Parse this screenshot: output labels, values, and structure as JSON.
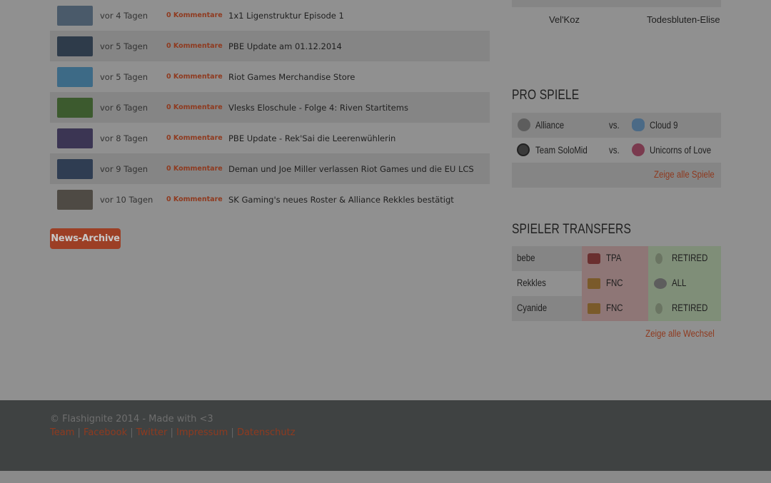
{
  "news": [
    {
      "ago": "vor 4 Tagen",
      "comments": "0 Kommentare",
      "title": "1x1 Ligenstruktur Episode 1",
      "thumb_color": "#4a5a6a",
      "alt": false
    },
    {
      "ago": "vor 5 Tagen",
      "comments": "0 Kommentare",
      "title": "PBE Update am 01.12.2014",
      "thumb_color": "#2e3b4a",
      "alt": true
    },
    {
      "ago": "vor 5 Tagen",
      "comments": "0 Kommentare",
      "title": "Riot Games Merchandise Store",
      "thumb_color": "#3d6a86",
      "alt": false
    },
    {
      "ago": "vor 6 Tagen",
      "comments": "0 Kommentare",
      "title": "Vlesks Eloschule - Folge 4: Riven Startitems",
      "thumb_color": "#3c5a2e",
      "alt": true
    },
    {
      "ago": "vor 8 Tagen",
      "comments": "0 Kommentare",
      "title": "PBE Update - Rek'Sai die Leerenwühlerin",
      "thumb_color": "#3b3553",
      "alt": false
    },
    {
      "ago": "vor 9 Tagen",
      "comments": "0 Kommentare",
      "title": "Deman und Joe Miller verlassen Riot Games und die EU LCS",
      "thumb_color": "#2f3d52",
      "alt": true
    },
    {
      "ago": "vor 10 Tagen",
      "comments": "0 Kommentare",
      "title": "SK Gaming's neues Roster & Alliance Rekkles bestätigt",
      "thumb_color": "#4e4a44",
      "alt": false
    }
  ],
  "archive_button": "News-Archive",
  "champions": {
    "left": "Vel'Koz",
    "right": "Todesbluten-Elise"
  },
  "pro_games": {
    "title": "PRO SPIELE",
    "matches": [
      {
        "team1": "Alliance",
        "vs": "vs.",
        "team2": "Cloud 9",
        "icon1": "alliance-logo-icon",
        "icon2": "cloud9-logo-icon"
      },
      {
        "team1": "Team SoloMid",
        "vs": "vs.",
        "team2": "Unicorns of Love",
        "icon1": "tsm-logo-icon",
        "icon2": "unicorns-of-love-logo-icon"
      }
    ],
    "show_all": "Zeige alle Spiele"
  },
  "transfers": {
    "title": "SPIELER TRANSFERS",
    "rows": [
      {
        "player": "bebe",
        "from": "TPA",
        "to": "RETIRED"
      },
      {
        "player": "Rekkles",
        "from": "FNC",
        "to": "ALL"
      },
      {
        "player": "Cyanide",
        "from": "FNC",
        "to": "RETIRED"
      }
    ],
    "show_all": "Zeige alle Wechsel"
  },
  "footer": {
    "copyright": "© Flashignite 2014 - Made with <3",
    "links": [
      "Team",
      "Facebook",
      "Twitter",
      "Impressum",
      "Datenschutz"
    ]
  },
  "colors": {
    "accent": "#9c3f25",
    "overlay_bg": "#909090",
    "footer_bg": "#3f4242"
  }
}
